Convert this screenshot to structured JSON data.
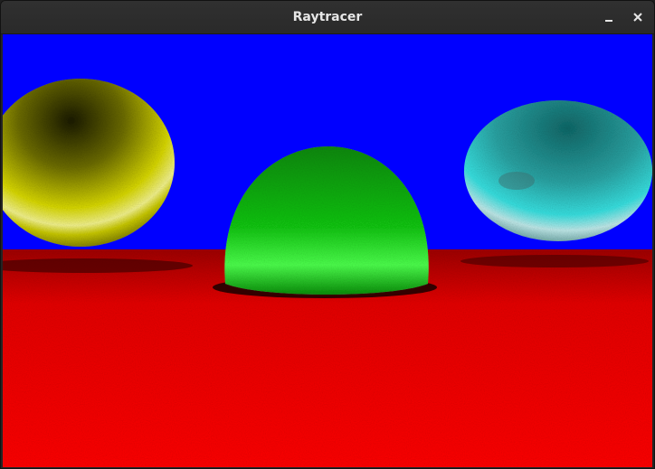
{
  "window": {
    "title": "Raytracer",
    "controls": {
      "minimize_icon": "minimize-icon",
      "close_icon": "close-icon"
    }
  },
  "scene": {
    "sky_color": "#0000ff",
    "floor_color": "#ff0000",
    "spheres": [
      {
        "name": "yellow-sphere",
        "color": "#d8d800"
      },
      {
        "name": "green-sphere",
        "color": "#0fcf0f"
      },
      {
        "name": "cyan-sphere",
        "color": "#26d4d4"
      }
    ]
  }
}
